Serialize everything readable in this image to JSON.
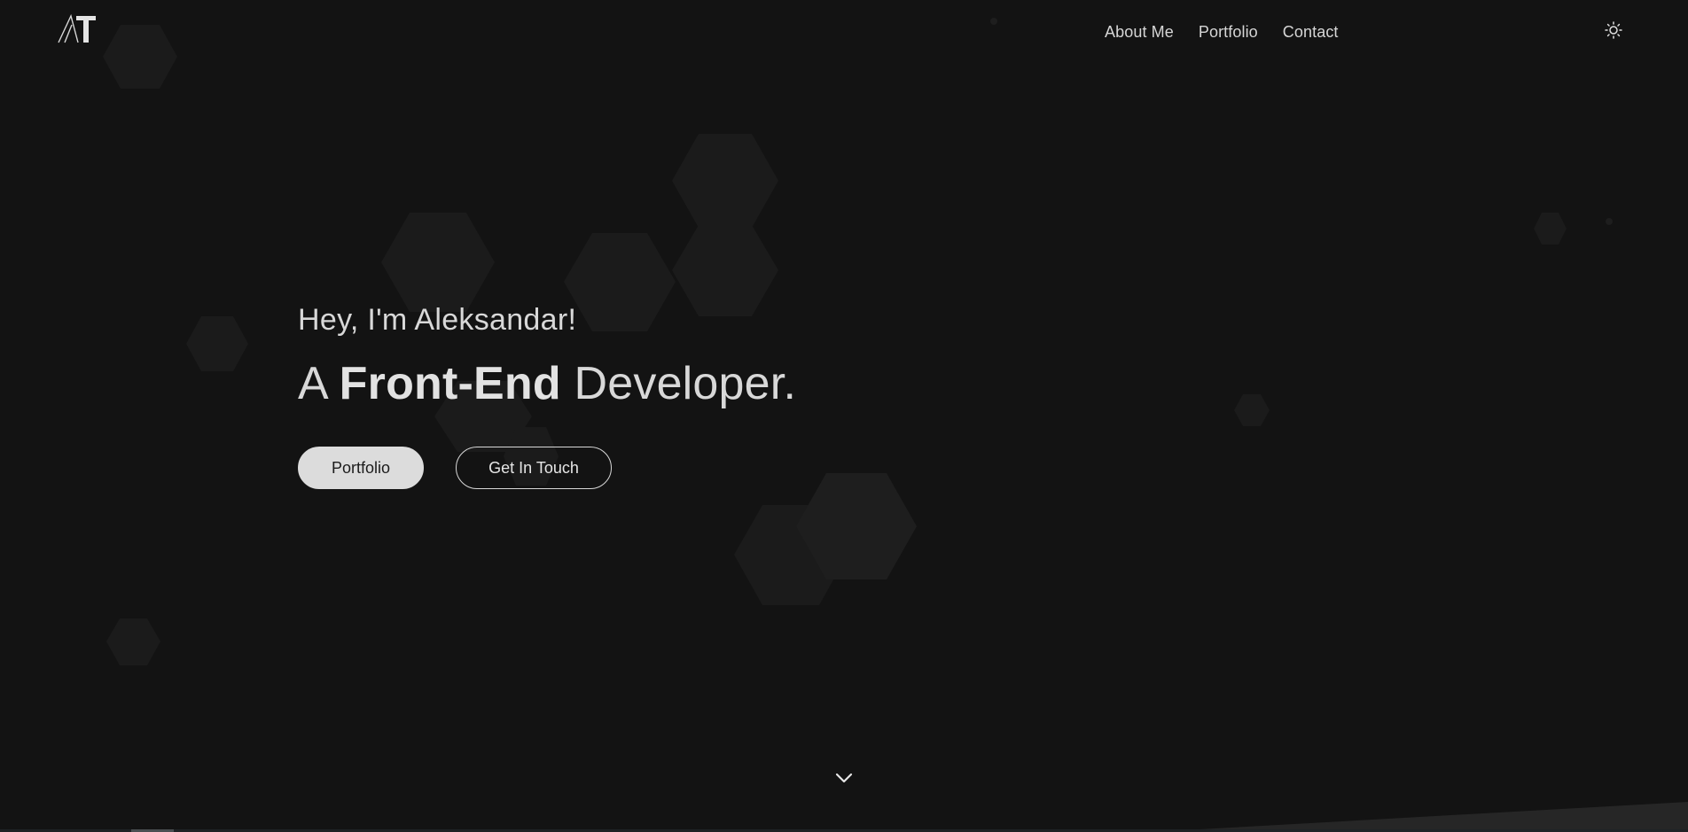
{
  "header": {
    "logo_icon": "at-monogram-logo",
    "nav": [
      {
        "label": "About Me"
      },
      {
        "label": "Portfolio"
      },
      {
        "label": "Contact"
      }
    ],
    "theme_toggle_icon": "sun-icon"
  },
  "hero": {
    "greeting": "Hey, I'm Aleksandar!",
    "headline": {
      "prefix": "A ",
      "emphasis": "Front-End",
      "suffix": " Developer."
    },
    "buttons": {
      "primary": "Portfolio",
      "secondary": "Get In Touch"
    },
    "scroll_icon": "chevron-down-icon"
  },
  "theme": {
    "background": "#131313",
    "hexagon": "#1b1b1b",
    "text": "#d8d8d8",
    "button_fill": "#dcdcdc"
  }
}
